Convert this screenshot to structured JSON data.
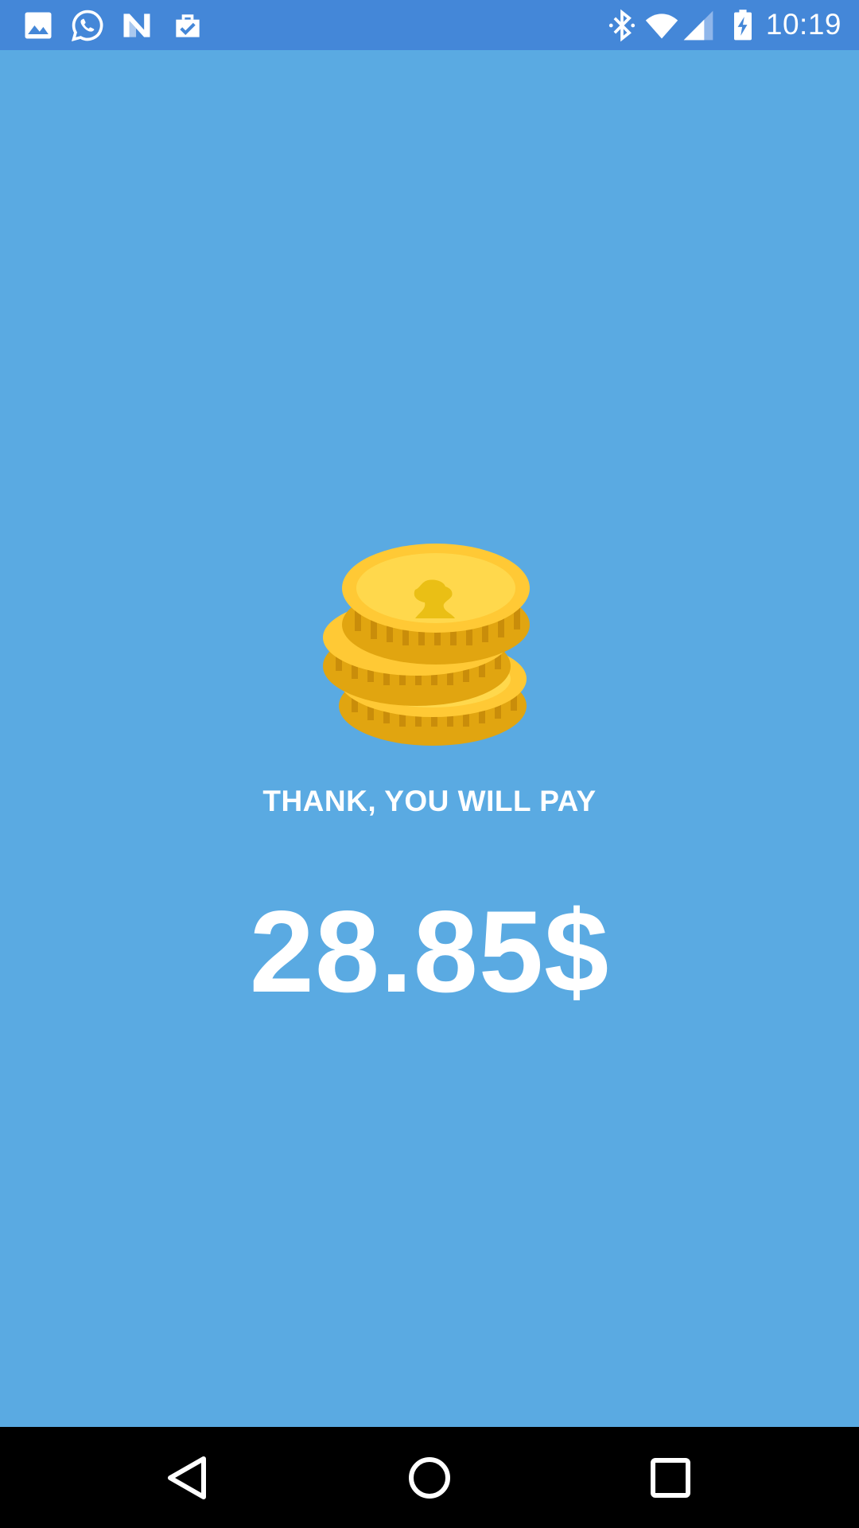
{
  "status_bar": {
    "time": "10:19",
    "left_icons": [
      "gallery-icon",
      "whatsapp-icon",
      "n-app-icon",
      "task-clipboard-icon"
    ],
    "right_icons": [
      "bluetooth-icon",
      "wifi-icon",
      "cell-signal-icon",
      "battery-charging-icon"
    ],
    "background_color": "#4487d8"
  },
  "main": {
    "background_color": "#5aaae2",
    "illustration": "gold-coins-icon",
    "message": "THANK, YOU WILL PAY",
    "amount": "28.85$"
  },
  "nav_bar": {
    "buttons": [
      "back-icon",
      "home-icon",
      "recents-icon"
    ]
  }
}
